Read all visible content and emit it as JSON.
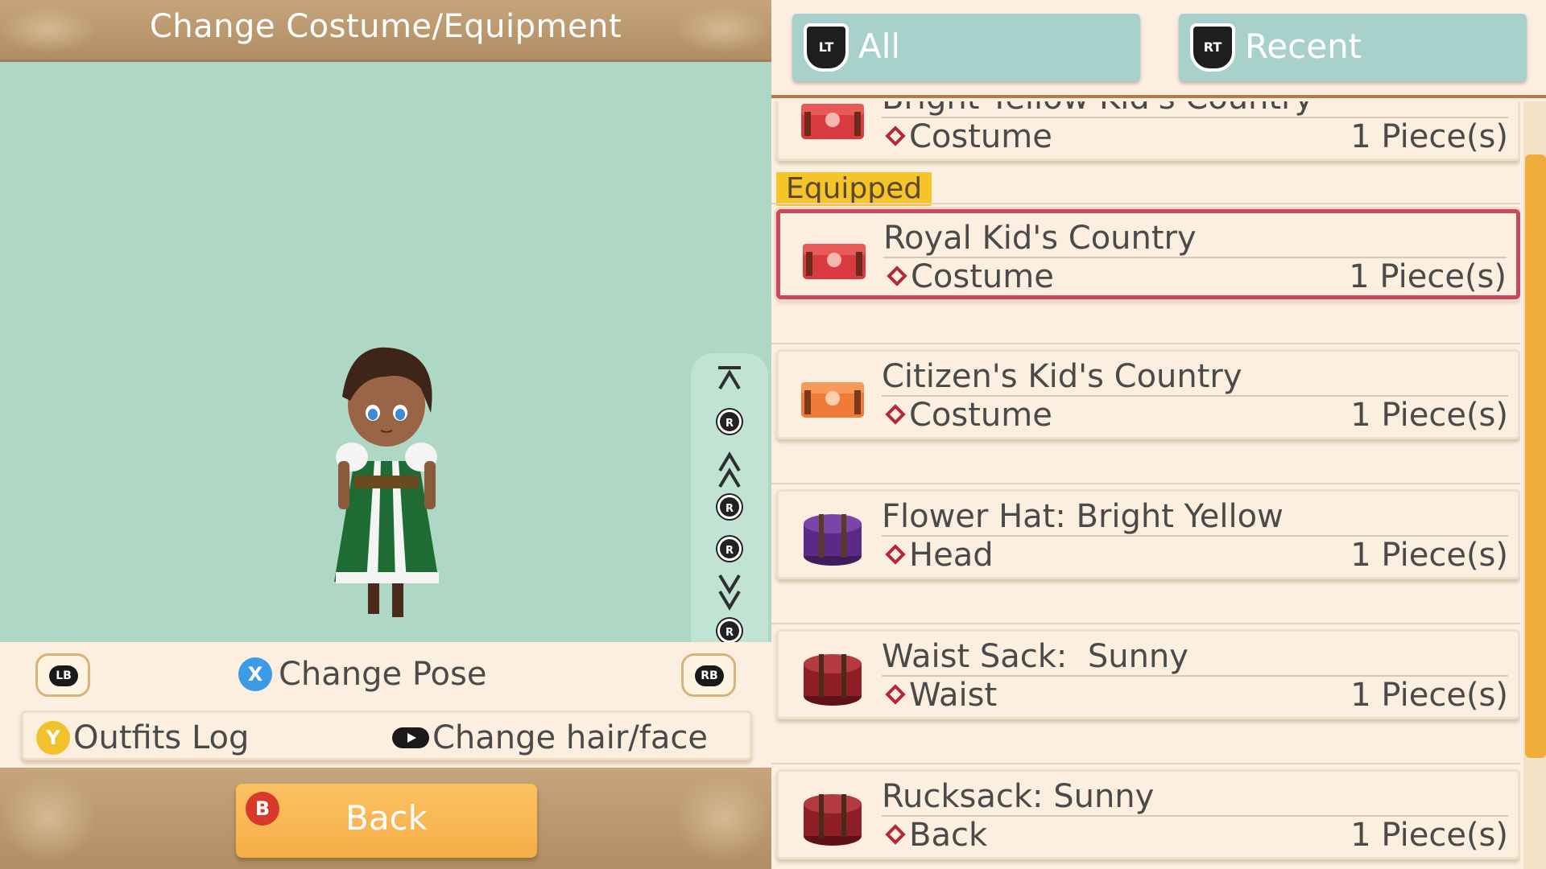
{
  "left_panel": {
    "title": "Change Costume/Equipment",
    "controls": {
      "lb_label": "LB",
      "rb_label": "RB",
      "change_pose": {
        "button": "X",
        "label": "Change Pose",
        "color": "#3c9be6"
      },
      "outfits_log": {
        "button": "Y",
        "label": "Outfits Log",
        "color": "#f2c12e"
      },
      "change_hair_face": {
        "label": "Change hair/face"
      }
    },
    "back_button": {
      "button": "B",
      "label": "Back"
    },
    "camera_rail": {
      "r_label": "R"
    }
  },
  "right_panel": {
    "tabs": [
      {
        "shoulder": "LT",
        "label": "All"
      },
      {
        "shoulder": "RT",
        "label": "Recent"
      }
    ],
    "equipped_tag": "Equipped",
    "items": [
      {
        "name": "Bright Yellow Kid's Country",
        "category": "Costume",
        "quantity": "1 Piece(s)",
        "icon": "red-trunk-icon",
        "color": "#d93a3f"
      },
      {
        "name": "Royal Kid's Country",
        "category": "Costume",
        "quantity": "1 Piece(s)",
        "icon": "red-trunk-icon",
        "color": "#d93a3f",
        "selected": true
      },
      {
        "name": "Citizen's Kid's Country",
        "category": "Costume",
        "quantity": "1 Piece(s)",
        "icon": "orange-trunk-icon",
        "color": "#f07a37"
      },
      {
        "name": "Flower Hat: Bright Yellow",
        "category": "Head",
        "quantity": "1 Piece(s)",
        "icon": "purple-hatbox-icon",
        "color": "#5b2a86"
      },
      {
        "name": "Waist Sack:  Sunny",
        "category": "Waist",
        "quantity": "1 Piece(s)",
        "icon": "red-hatbox-icon",
        "color": "#8e1f27"
      },
      {
        "name": "Rucksack: Sunny",
        "category": "Back",
        "quantity": "1 Piece(s)",
        "icon": "red-hatbox-icon",
        "color": "#8e1f27"
      }
    ]
  },
  "colors": {
    "preview_bg": "#afd7c6",
    "panel_bg": "#fcefe0",
    "accent_orange": "#f0ad3c",
    "selected_border": "#c74a5a",
    "tab_bg": "#a8d1cc"
  }
}
